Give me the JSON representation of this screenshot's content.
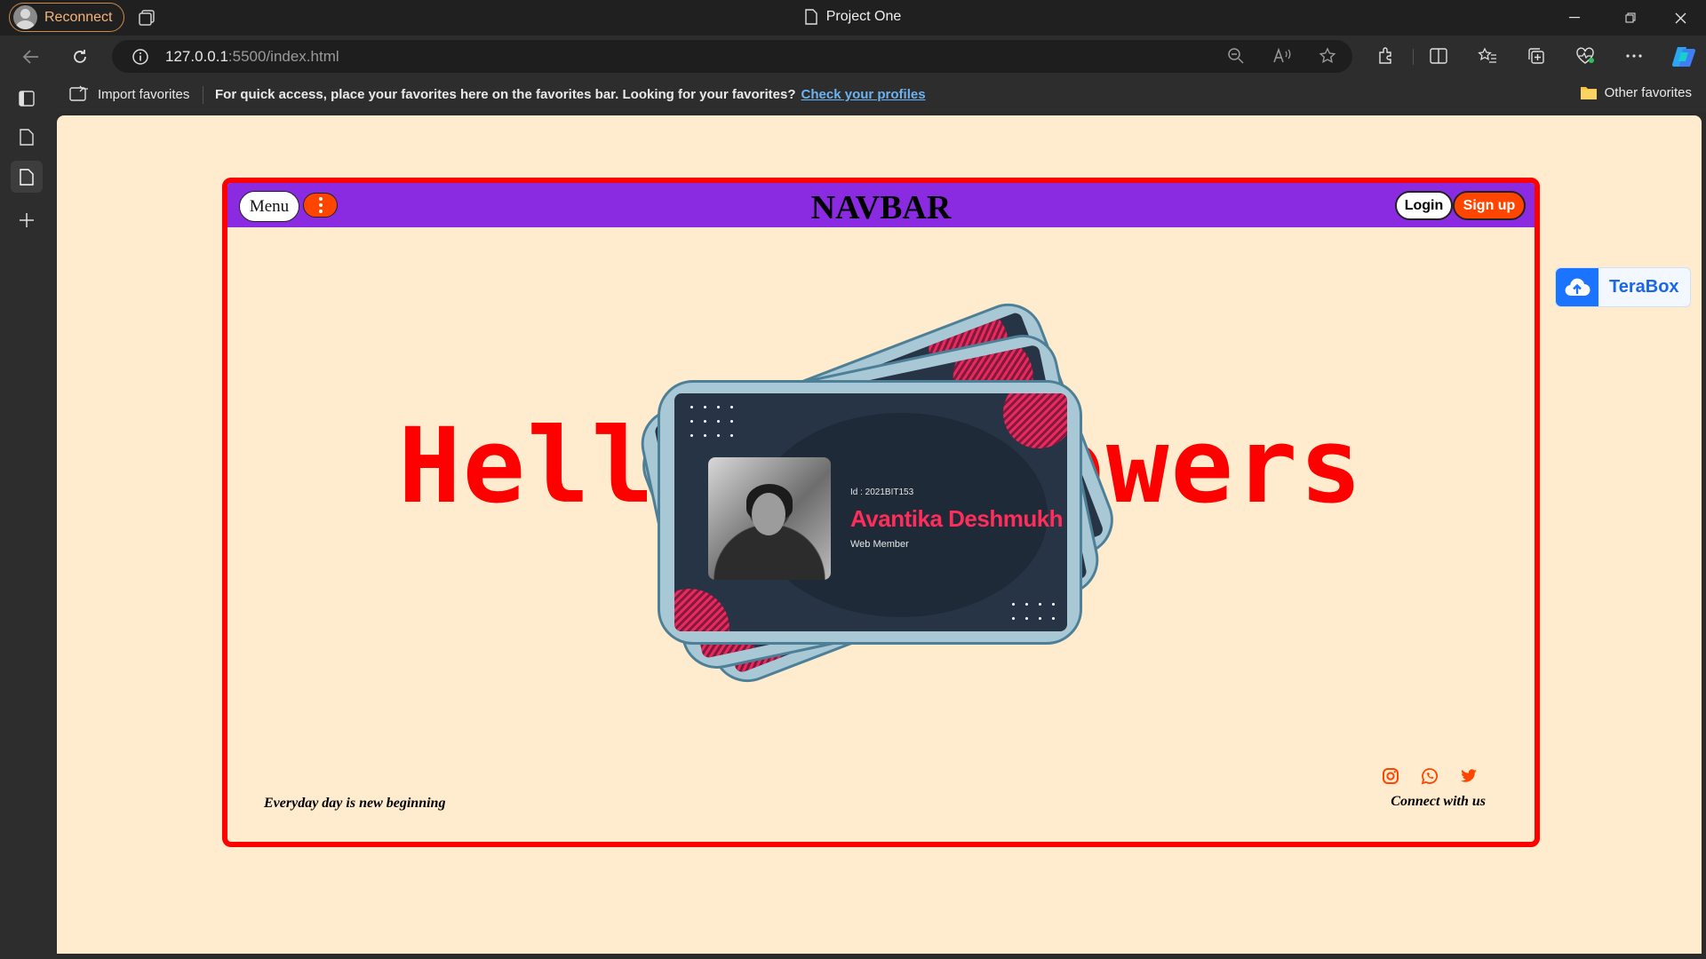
{
  "browser": {
    "profile_button": "Reconnect",
    "window_title": "Project One",
    "url_host": "127.0.0.1",
    "url_path": ":5500/index.html"
  },
  "favorites_bar": {
    "import": "Import favorites",
    "message": "For quick access, place your favorites here on the favorites bar. Looking for your favorites?",
    "link": "Check your profiles",
    "other": "Other favorites"
  },
  "page": {
    "navbar": {
      "menu": "Menu",
      "title": "NAVBAR",
      "login": "Login",
      "signup": "Sign up"
    },
    "hero": "Hello Followers",
    "card": {
      "id": "Id : 2021BIT153",
      "name": "Avantika Deshmukh",
      "role": "Web Member"
    },
    "footer": {
      "tagline": "Everyday day is new beginning",
      "connect": "Connect with us"
    }
  },
  "extension": {
    "label": "TeraBox"
  },
  "colors": {
    "page_bg": "#ffebcd",
    "frame_border": "#ff0000",
    "navbar_bg": "#8a2be2",
    "accent": "#ff4500",
    "hero_text": "#ff0000",
    "card_name": "#ff2d5a"
  }
}
